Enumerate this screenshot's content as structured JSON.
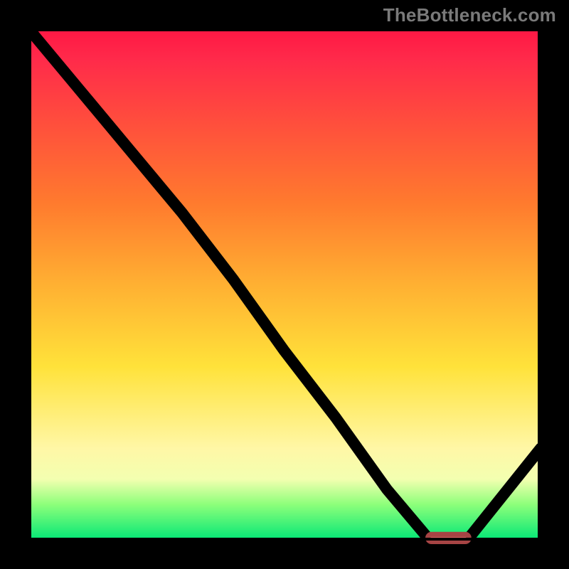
{
  "watermark": "TheBottleneck.com",
  "colors": {
    "gradient_top": "#ff1744",
    "gradient_mid1": "#ff7a2e",
    "gradient_mid2": "#ffe23a",
    "gradient_mid3": "#fff7a6",
    "gradient_bottom": "#00e676",
    "curve": "#000000",
    "marker": "#e06666",
    "background": "#000000"
  },
  "chart_data": {
    "type": "line",
    "title": "",
    "xlabel": "",
    "ylabel": "",
    "xlim": [
      0,
      100
    ],
    "ylim": [
      0,
      100
    ],
    "grid": false,
    "legend": false,
    "series": [
      {
        "name": "curve",
        "x": [
          0,
          10,
          20,
          25,
          30,
          40,
          50,
          60,
          70,
          78,
          82,
          86,
          100
        ],
        "y": [
          100,
          88,
          76,
          70,
          64,
          51,
          37,
          24,
          10,
          0.5,
          0.5,
          0.5,
          18
        ]
      }
    ],
    "annotations": [
      {
        "name": "marker-band",
        "type": "rounded-bar",
        "x_start": 78,
        "x_end": 86,
        "y": 0.5,
        "color": "#e06666"
      }
    ],
    "background_gradient_stops": [
      {
        "pos": 0.0,
        "color": "#ff1744"
      },
      {
        "pos": 0.34,
        "color": "#ff7a2e"
      },
      {
        "pos": 0.66,
        "color": "#ffe23a"
      },
      {
        "pos": 0.88,
        "color": "#f3ffb0"
      },
      {
        "pos": 1.0,
        "color": "#00e676"
      }
    ]
  }
}
